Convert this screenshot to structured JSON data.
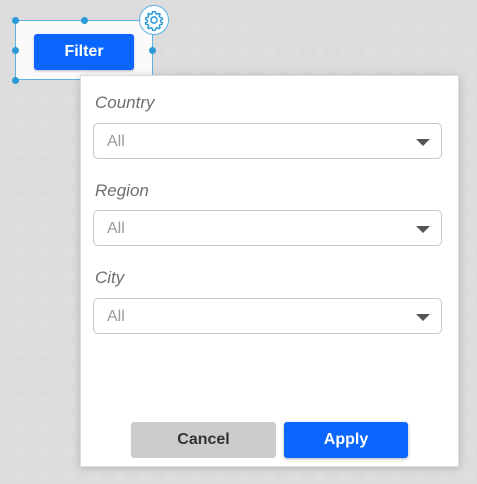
{
  "widget": {
    "filter_label": "Filter",
    "accent": "#0a66ff",
    "frame_color": "#5ab4e0",
    "settings_icon": "gear-icon"
  },
  "panel": {
    "fields": [
      {
        "label": "Country",
        "value": "All"
      },
      {
        "label": "Region",
        "value": "All"
      },
      {
        "label": "City",
        "value": "All"
      }
    ],
    "cancel_label": "Cancel",
    "apply_label": "Apply"
  }
}
